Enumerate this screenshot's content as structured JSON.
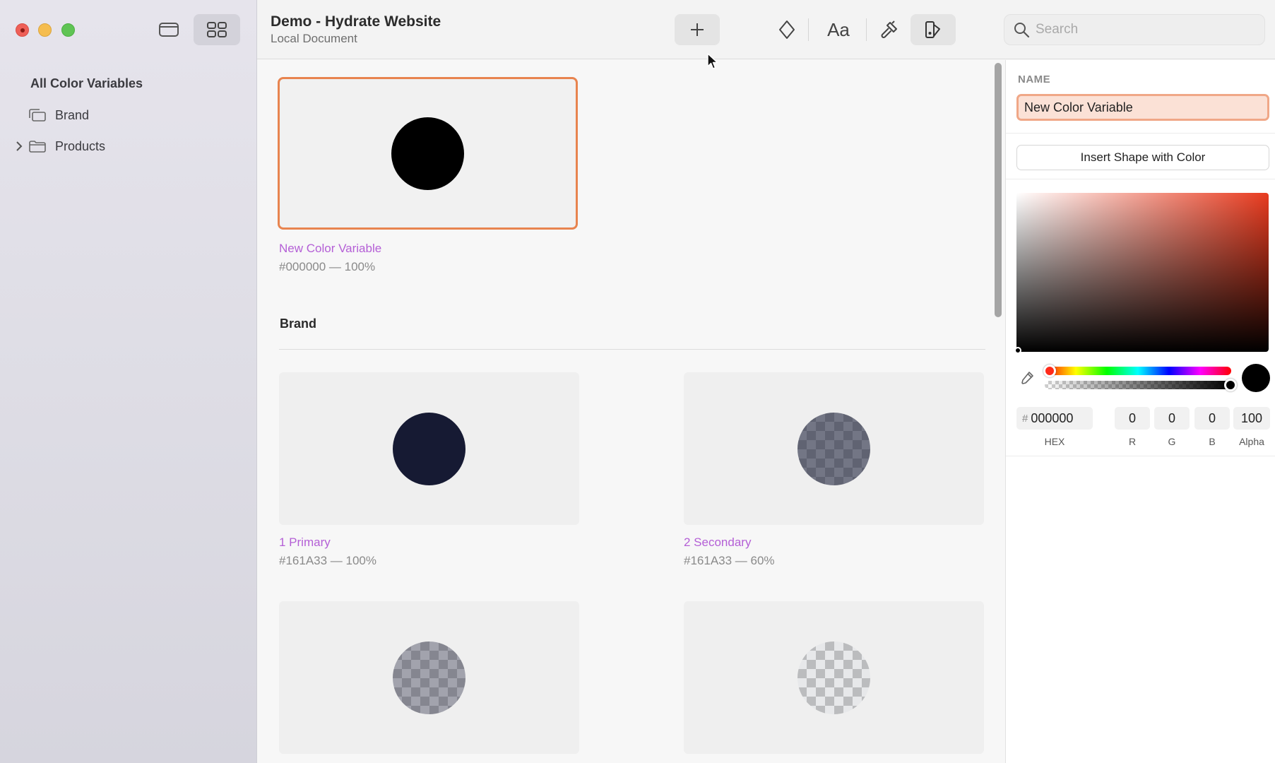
{
  "window": {
    "title": "Demo - Hydrate Website",
    "subtitle": "Local Document"
  },
  "sidebar": {
    "heading": "All Color Variables",
    "items": [
      {
        "label": "Brand",
        "icon": "stack-folder-icon"
      },
      {
        "label": "Products",
        "icon": "folder-icon",
        "collapsed": true
      }
    ]
  },
  "toolbar": {
    "buttons": [
      "add-icon",
      "diamond-icon",
      "text-style-icon",
      "hammer-icon",
      "color-style-icon"
    ],
    "text_style_glyph": "Aa",
    "search_placeholder": "Search"
  },
  "colors": {
    "accent": "#b45fd6",
    "selection": "#e8844f",
    "brand_primary": "#161A33"
  },
  "main": {
    "selected_variable": {
      "name": "New Color Variable",
      "value": "#000000 — 100%",
      "hex": "#000000",
      "alpha": 1.0
    },
    "section_title": "Brand",
    "variables": [
      {
        "name": "1 Primary",
        "value": "#161A33 — 100%",
        "hex": "#161A33",
        "alpha": 1.0
      },
      {
        "name": "2 Secondary",
        "value": "#161A33 — 60%",
        "hex": "#161A33",
        "alpha": 0.6
      },
      {
        "name": "",
        "value": "",
        "hex": "#161A33",
        "alpha": 0.4
      },
      {
        "name": "",
        "value": "",
        "hex": "#161A33",
        "alpha": 0.1
      }
    ]
  },
  "inspector": {
    "name_label": "NAME",
    "name_value": "New Color Variable",
    "insert_button": "Insert Shape with Color",
    "hex_prefix": "#",
    "hex": "000000",
    "r": "0",
    "g": "0",
    "b": "0",
    "alpha": "100",
    "captions": {
      "hex": "HEX",
      "r": "R",
      "g": "G",
      "b": "B",
      "alpha": "Alpha"
    }
  }
}
